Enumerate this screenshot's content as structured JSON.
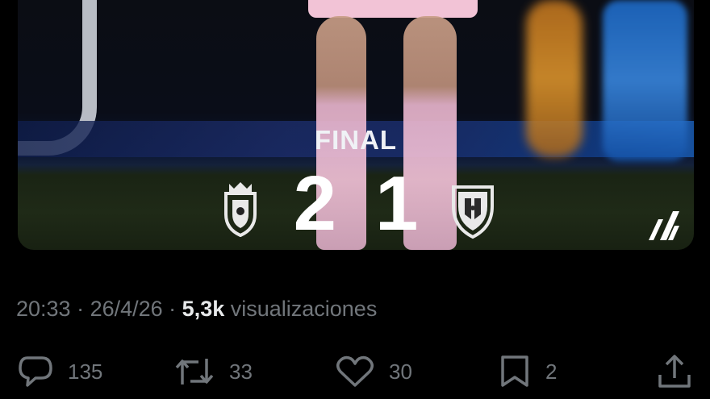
{
  "media": {
    "status_label": "FINAL",
    "home_score": "2",
    "away_score": "1",
    "home_crest_icon": "osasuna-crest-icon",
    "away_crest_icon": "sevilla-crest-icon",
    "league_logo_icon": "laliga-logo-icon"
  },
  "post_meta": {
    "time": "20:33",
    "separator_1": " · ",
    "date": "26/4/26",
    "separator_2": " · ",
    "views_count": "5,3k",
    "views_label": " visualizaciones"
  },
  "actions": {
    "reply_icon": "reply-icon",
    "reply_count": "135",
    "repost_icon": "repost-icon",
    "repost_count": "33",
    "like_icon": "heart-icon",
    "like_count": "30",
    "bookmark_icon": "bookmark-icon",
    "bookmark_count": "2",
    "share_icon": "share-icon"
  },
  "colors": {
    "background": "#000000",
    "muted_text": "#71767b",
    "primary_text": "#e7e9ea"
  }
}
